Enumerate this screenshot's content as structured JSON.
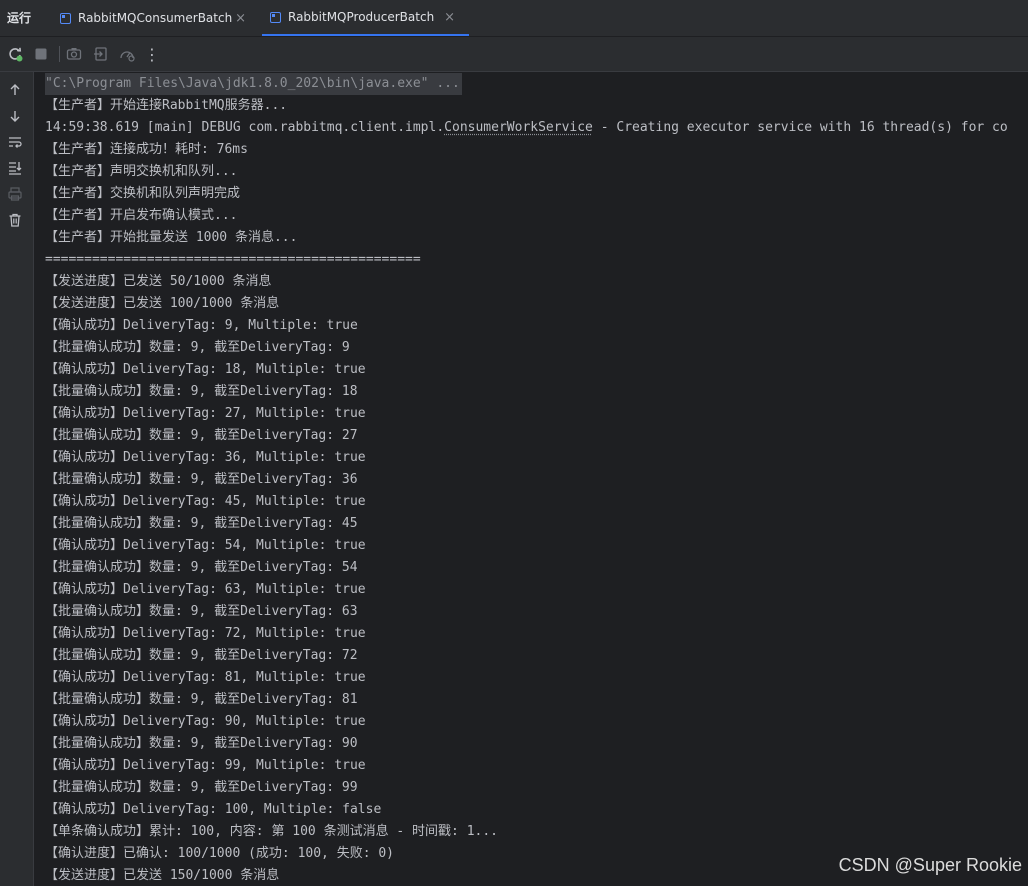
{
  "window": {
    "run_label": "运行",
    "tabs": [
      {
        "label": "RabbitMQConsumerBatch",
        "close": "×",
        "active": false
      },
      {
        "label": "RabbitMQProducerBatch",
        "close": "×",
        "active": true
      }
    ]
  },
  "toolbar": {
    "buttons": [
      "rerun-icon",
      "stop-icon",
      "camera-icon",
      "exit-icon",
      "gauge-icon",
      "more-icon"
    ],
    "more_label": "⋮"
  },
  "sidebar": {
    "buttons": [
      "arrow-up-icon",
      "arrow-down-icon",
      "soft-wrap-icon",
      "scroll-to-end-icon",
      "print-icon",
      "trash-icon"
    ]
  },
  "console": {
    "command": "\"C:\\Program Files\\Java\\jdk1.8.0_202\\bin\\java.exe\" ...",
    "debug_line": {
      "prefix": "14:59:38.619 [main] DEBUG com.rabbitmq.client.impl.",
      "link": "ConsumerWorkService",
      "suffix": " - Creating executor service with 16 thread(s) for co"
    },
    "lines": [
      "【生产者】开始连接RabbitMQ服务器...",
      "【生产者】连接成功！耗时: 76ms",
      "【生产者】声明交换机和队列...",
      "【生产者】交换机和队列声明完成",
      "【生产者】开启发布确认模式...",
      "【生产者】开始批量发送 1000 条消息...",
      "================================================",
      "【发送进度】已发送 50/1000 条消息",
      "【发送进度】已发送 100/1000 条消息",
      "【确认成功】DeliveryTag: 9, Multiple: true",
      "【批量确认成功】数量: 9, 截至DeliveryTag: 9",
      "【确认成功】DeliveryTag: 18, Multiple: true",
      "【批量确认成功】数量: 9, 截至DeliveryTag: 18",
      "【确认成功】DeliveryTag: 27, Multiple: true",
      "【批量确认成功】数量: 9, 截至DeliveryTag: 27",
      "【确认成功】DeliveryTag: 36, Multiple: true",
      "【批量确认成功】数量: 9, 截至DeliveryTag: 36",
      "【确认成功】DeliveryTag: 45, Multiple: true",
      "【批量确认成功】数量: 9, 截至DeliveryTag: 45",
      "【确认成功】DeliveryTag: 54, Multiple: true",
      "【批量确认成功】数量: 9, 截至DeliveryTag: 54",
      "【确认成功】DeliveryTag: 63, Multiple: true",
      "【批量确认成功】数量: 9, 截至DeliveryTag: 63",
      "【确认成功】DeliveryTag: 72, Multiple: true",
      "【批量确认成功】数量: 9, 截至DeliveryTag: 72",
      "【确认成功】DeliveryTag: 81, Multiple: true",
      "【批量确认成功】数量: 9, 截至DeliveryTag: 81",
      "【确认成功】DeliveryTag: 90, Multiple: true",
      "【批量确认成功】数量: 9, 截至DeliveryTag: 90",
      "【确认成功】DeliveryTag: 99, Multiple: true",
      "【批量确认成功】数量: 9, 截至DeliveryTag: 99",
      "【确认成功】DeliveryTag: 100, Multiple: false",
      "【单条确认成功】累计: 100, 内容: 第 100 条测试消息 - 时间戳: 1...",
      "【确认进度】已确认: 100/1000 (成功: 100, 失败: 0)",
      "【发送进度】已发送 150/1000 条消息"
    ]
  },
  "watermark": "CSDN @Super Rookie",
  "colors": {
    "background": "#1e1f22",
    "panel": "#2b2d30",
    "text": "#bcbec4",
    "accent": "#3574f0",
    "rerun_green": "#5fb865"
  }
}
